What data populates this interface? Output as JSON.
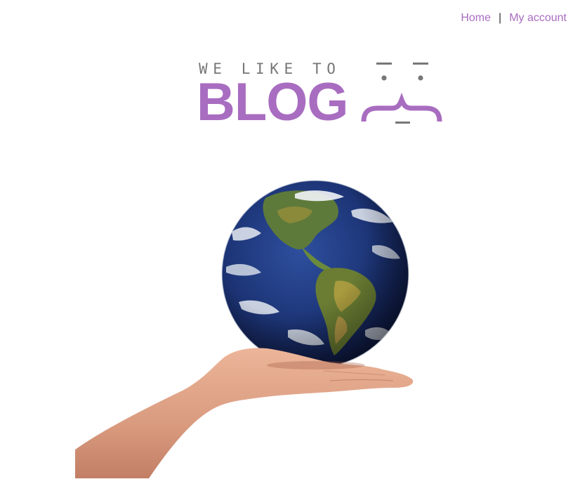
{
  "nav": {
    "home_label": "Home",
    "separator": "|",
    "account_label": "My account"
  },
  "logo": {
    "tagline": "WE LIKE TO",
    "word": "BLOG",
    "icon": "curly-brace-face-icon"
  },
  "hero": {
    "image": "hand-holding-globe"
  },
  "colors": {
    "brand_purple": "#a86dc0",
    "tagline_gray": "#777777",
    "text_dark": "#333333"
  }
}
